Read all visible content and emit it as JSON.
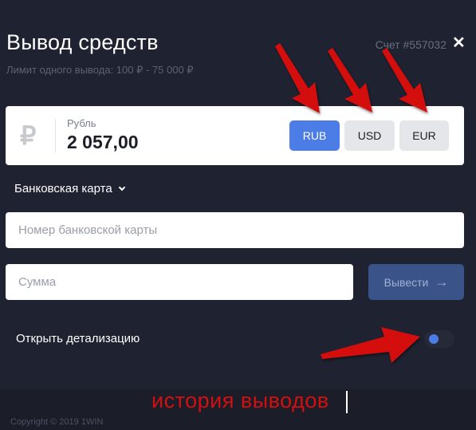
{
  "header": {
    "title": "Вывод средств",
    "limit_text": "Лимит одного вывода: 100 ₽ - 75 000 ₽",
    "account_text": "Счет #557032",
    "close_symbol": "✕"
  },
  "balance": {
    "currency_symbol": "₽",
    "currency_name": "Рубль",
    "amount": "2 057,00"
  },
  "currency_buttons": {
    "rub": "RUB",
    "usd": "USD",
    "eur": "EUR"
  },
  "method": {
    "selected": "Банковская карта"
  },
  "inputs": {
    "card_number_placeholder": "Номер банковской карты",
    "card_number_value": "",
    "sum_placeholder": "Сумма",
    "sum_value": ""
  },
  "withdraw_button": {
    "label": "Вывести",
    "icon": "arrow-right-icon"
  },
  "details": {
    "label": "Открыть детализацию",
    "toggle_on": false
  },
  "annotation": {
    "text": "история выводов",
    "color": "#d40f0f"
  },
  "footer": {
    "copyright": "Copyright © 2019 1WIN"
  },
  "colors": {
    "background": "#1f2230",
    "accent": "#4c7ce6",
    "arrow": "#d40f0f"
  }
}
